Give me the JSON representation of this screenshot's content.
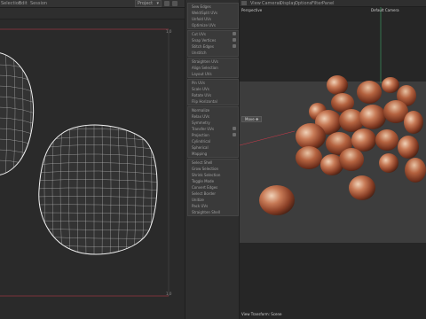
{
  "uv_editor": {
    "menu": [
      "Selection",
      "Edit",
      "Session"
    ],
    "select_value": "Project",
    "corner_label_top": "1,0",
    "corner_label_bottom": "1,0"
  },
  "tool_panel": {
    "groups": [
      {
        "rows": [
          "Sew Edges",
          "Weld/Split UVs",
          "Unfold UVs",
          "Optimize UVs"
        ]
      },
      {
        "rows": [
          "Cut UVs",
          "Snap Vertices",
          "Stitch Edges",
          "Unstitch"
        ]
      },
      {
        "rows": [
          "Straighten UVs",
          "Align Selection",
          "Layout UVs"
        ]
      },
      {
        "rows": [
          "Pin UVs",
          "Scale UVs",
          "Rotate UVs",
          "Flip Horizontal"
        ]
      },
      {
        "rows": [
          "Normalize",
          "Relax UVs",
          "Symmetry",
          "Transfer UVs",
          "Projection",
          "Cylindrical",
          "Spherical",
          "Mapping"
        ]
      },
      {
        "rows": [
          "Select Shell",
          "Grow Selection",
          "Shrink Selection",
          "Toggle Mode",
          "Convert Edges",
          "Select Border",
          "Unitize",
          "Pack UVs",
          "Straighten Shell"
        ]
      }
    ]
  },
  "viewport": {
    "menu": [
      "View",
      "Cameras",
      "Display",
      "Options",
      "Filter",
      "Panel"
    ],
    "camera_label": "Perspective",
    "camera_name": "Default Camera",
    "move_label": "Move",
    "status": "View Transform: Scene"
  },
  "colors": {
    "accent_line": "#cc3a4a",
    "axis_green": "#3ea86a",
    "uv_wire": "#e6e6e6"
  }
}
